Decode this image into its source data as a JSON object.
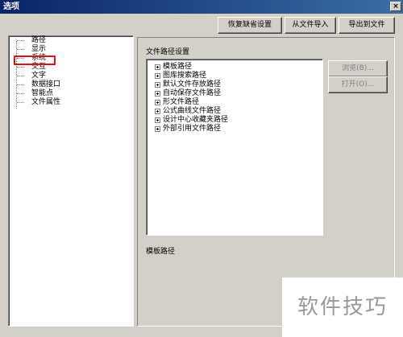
{
  "window": {
    "title": "选项",
    "close_glyph": "×"
  },
  "top_buttons": {
    "restore_default": "恢复缺省设置",
    "import": "从文件导入",
    "export": "导出到文件"
  },
  "nav_tree": {
    "items": [
      {
        "label": "路径"
      },
      {
        "label": "显示"
      },
      {
        "label": "系统"
      },
      {
        "label": "交互"
      },
      {
        "label": "文字"
      },
      {
        "label": "数据接口"
      },
      {
        "label": "智能点"
      },
      {
        "label": "文件属性"
      }
    ],
    "selected": "系统"
  },
  "path_settings": {
    "group_label": "文件路径设置",
    "items": [
      {
        "label": "模板路径"
      },
      {
        "label": "图库搜索路径"
      },
      {
        "label": "默认文件存放路径"
      },
      {
        "label": "自动保存文件路径"
      },
      {
        "label": "形文件路径"
      },
      {
        "label": "公式曲线文件路径"
      },
      {
        "label": "设计中心收藏夹路径"
      },
      {
        "label": "外部引用文件路径"
      }
    ],
    "browse_label": "浏览(B)...",
    "open_label": "打开(O)...",
    "selected_path_label": "模板路径"
  },
  "watermark": {
    "text": "软件技巧"
  },
  "colors": {
    "titlebar_start": "#0a246a",
    "titlebar_end": "#3a6ea5",
    "dialog_bg": "#d4d0c8",
    "highlight": "#e0101a"
  },
  "icons": {
    "expand": "plus-box-icon",
    "close": "close-icon"
  }
}
